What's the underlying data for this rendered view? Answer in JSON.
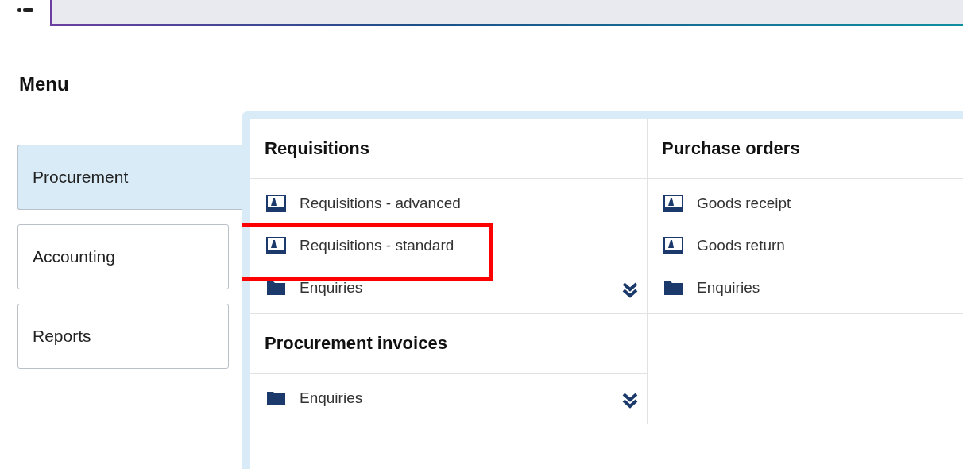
{
  "menu_title": "Menu",
  "categories": [
    {
      "label": "Procurement",
      "selected": true
    },
    {
      "label": "Accounting",
      "selected": false
    },
    {
      "label": "Reports",
      "selected": false
    }
  ],
  "sections": [
    {
      "title": "Requisitions",
      "show_more": true,
      "items": [
        {
          "kind": "screen",
          "label": "Requisitions - advanced",
          "highlighted": false
        },
        {
          "kind": "screen",
          "label": "Requisitions - standard",
          "highlighted": true
        },
        {
          "kind": "folder",
          "label": "Enquiries",
          "highlighted": false
        }
      ]
    },
    {
      "title": "Purchase orders",
      "show_more": false,
      "items": [
        {
          "kind": "screen",
          "label": "Goods receipt",
          "highlighted": false
        },
        {
          "kind": "screen",
          "label": "Goods return",
          "highlighted": false
        },
        {
          "kind": "folder",
          "label": "Enquiries",
          "highlighted": false
        }
      ]
    },
    {
      "title": "Procurement invoices",
      "show_more": true,
      "items": [
        {
          "kind": "folder",
          "label": "Enquiries",
          "highlighted": false
        }
      ]
    }
  ]
}
